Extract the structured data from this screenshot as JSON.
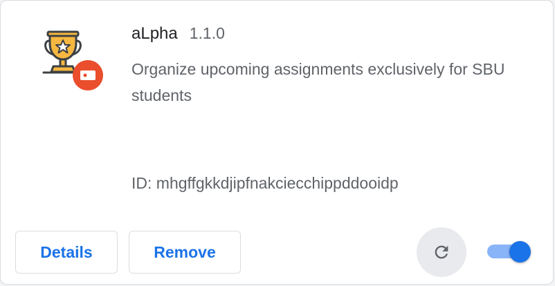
{
  "extension": {
    "name": "aLpha",
    "version": "1.1.0",
    "description": "Organize upcoming assignments exclusively for SBU students",
    "id_text": "ID: mhgffgkkdjipfnakciecchippddooidp",
    "icon": "trophy-star-icon",
    "badge_icon": "unpacked-extension-badge-icon"
  },
  "actions": {
    "details_label": "Details",
    "remove_label": "Remove",
    "reload_icon": "reload-icon",
    "enabled": true
  },
  "colors": {
    "accent": "#1a73e8",
    "toggle_track": "#8ab4f8",
    "badge": "#ea4e2c",
    "trophy": "#f4a623"
  }
}
